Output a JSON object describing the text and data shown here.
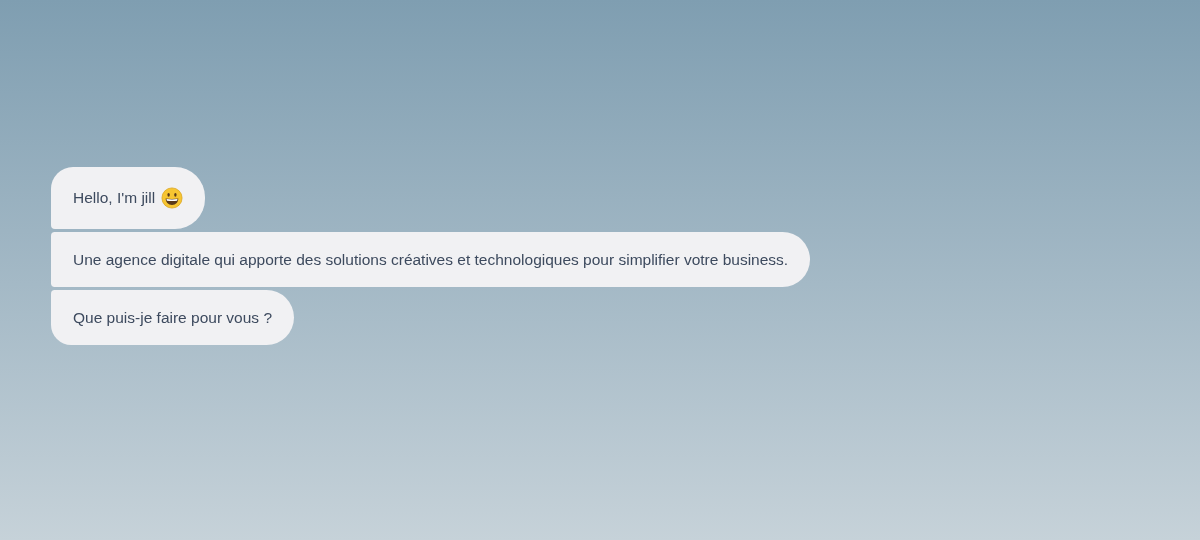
{
  "messages": [
    {
      "text": "Hello, I'm jill",
      "emoji": true
    },
    {
      "text": "Une agence digitale qui apporte des solutions créatives et technologiques pour simplifier votre business.",
      "emoji": false
    },
    {
      "text": "Que puis-je faire pour vous ?",
      "emoji": false
    }
  ]
}
